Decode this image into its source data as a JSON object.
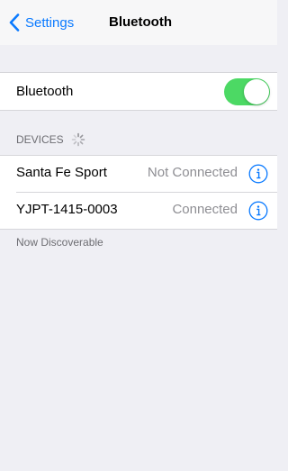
{
  "nav": {
    "back_label": "Settings",
    "title": "Bluetooth"
  },
  "bluetooth": {
    "label": "Bluetooth",
    "enabled": true,
    "toggle_color": "#4cd964"
  },
  "devices_section": {
    "header": "DEVICES",
    "loading_icon": "spinner-icon",
    "items": [
      {
        "name": "Santa Fe Sport",
        "status": "Not Connected",
        "icon": "info-icon"
      },
      {
        "name": "YJPT-1415-0003",
        "status": "Connected",
        "icon": "info-icon"
      }
    ]
  },
  "footer": {
    "text": "Now Discoverable"
  },
  "colors": {
    "accent": "#0a7aff",
    "background": "#efeff4",
    "secondary_text": "#8e8e93"
  }
}
